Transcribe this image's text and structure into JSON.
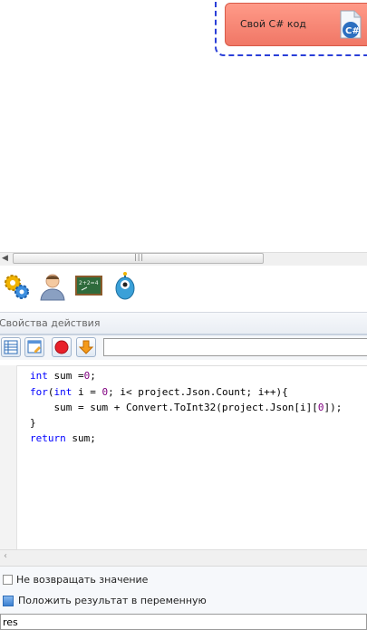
{
  "canvas": {
    "node_label": "Свой C# код",
    "node_icon": "csharp-file-icon",
    "node_color": "#f5806e",
    "selection_color": "#2a3fd8"
  },
  "toolbox": {
    "icons": [
      "gears-icon",
      "user-icon",
      "blackboard-icon",
      "robot-icon"
    ]
  },
  "properties": {
    "title": "Свойства действия",
    "toolbar_icons": [
      "grid-view-icon",
      "window-edit-icon",
      "record-icon",
      "download-arrow-icon"
    ],
    "input_value": ""
  },
  "editor": {
    "lines": [
      "int sum =0;",
      "for(int i = 0; i< project.Json.Count; i++){",
      "    sum = sum + Convert.ToInt32(project.Json[i][0]);",
      "}",
      "return sum;"
    ]
  },
  "options": {
    "no_return_label": "Не возвращать значение",
    "no_return_checked": false,
    "store_result_label": "Положить результат в переменную",
    "store_result_checked": true,
    "variable_value": "res"
  }
}
